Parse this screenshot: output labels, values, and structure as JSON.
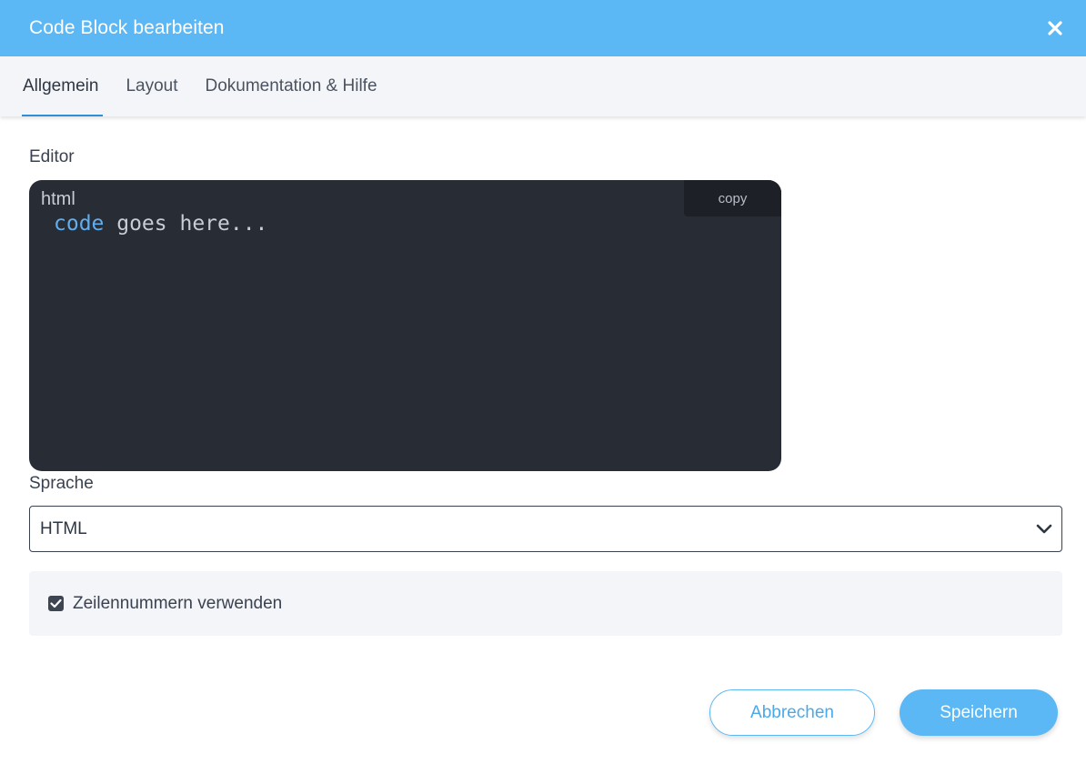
{
  "dialog": {
    "title": "Code Block bearbeiten",
    "close_icon": "close-icon"
  },
  "tabs": [
    {
      "label": "Allgemein",
      "active": true
    },
    {
      "label": "Layout",
      "active": false
    },
    {
      "label": "Dokumentation & Hilfe",
      "active": false
    }
  ],
  "editor": {
    "label": "Editor",
    "language_tag": "html",
    "copy_label": "copy",
    "code": {
      "keyword": "code",
      "rest": " goes here..."
    }
  },
  "language": {
    "label": "Sprache",
    "selected": "HTML"
  },
  "line_numbers": {
    "label": "Zeilennummern verwenden",
    "checked": true
  },
  "footer": {
    "cancel_label": "Abbrechen",
    "save_label": "Speichern"
  },
  "colors": {
    "header": "#5bb8f5",
    "editor_bg": "#282c35",
    "keyword": "#61aeee",
    "accent": "#2f8fd6"
  }
}
